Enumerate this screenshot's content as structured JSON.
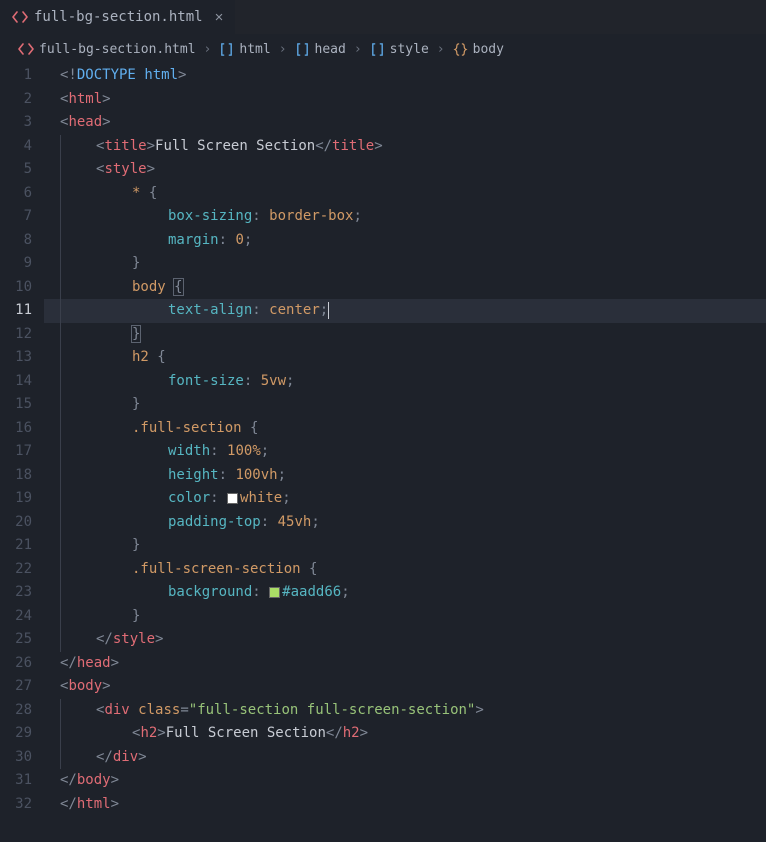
{
  "tab": {
    "file": "full-bg-section.html",
    "iconColor": "#e06c75"
  },
  "breadcrumbs": {
    "file": "full-bg-section.html",
    "parts": [
      "html",
      "head",
      "style",
      "body"
    ]
  },
  "highlightLine": 11,
  "lineCount": 32,
  "code": {
    "l1": {
      "doctype": "DOCTYPE",
      "root": "html"
    },
    "l2": {
      "tag": "html"
    },
    "l3": {
      "tag": "head"
    },
    "l4": {
      "tag": "title",
      "text": "Full Screen Section"
    },
    "l5": {
      "tag": "style"
    },
    "l6": {
      "selector": "*"
    },
    "l7": {
      "prop": "box-sizing",
      "val": "border-box"
    },
    "l8": {
      "prop": "margin",
      "val": "0"
    },
    "l10": {
      "selector": "body"
    },
    "l11": {
      "prop": "text-align",
      "val": "center"
    },
    "l13": {
      "selector": "h2"
    },
    "l14": {
      "prop": "font-size",
      "val": "5vw"
    },
    "l16": {
      "selector": ".full-section"
    },
    "l17": {
      "prop": "width",
      "val": "100%"
    },
    "l18": {
      "prop": "height",
      "val": "100vh"
    },
    "l19": {
      "prop": "color",
      "val": "white",
      "swatch": "#ffffff"
    },
    "l20": {
      "prop": "padding-top",
      "val": "45vh"
    },
    "l22": {
      "selector": ".full-screen-section"
    },
    "l23": {
      "prop": "background",
      "val": "#aadd66",
      "swatch": "#aadd66"
    },
    "l25": {
      "tag": "style"
    },
    "l26": {
      "tag": "head"
    },
    "l27": {
      "tag": "body"
    },
    "l28": {
      "tag": "div",
      "attr": "class",
      "attrVal": "full-section full-screen-section"
    },
    "l29": {
      "tag": "h2",
      "text": "Full Screen Section"
    },
    "l30": {
      "tag": "div"
    },
    "l31": {
      "tag": "body"
    },
    "l32": {
      "tag": "html"
    }
  }
}
